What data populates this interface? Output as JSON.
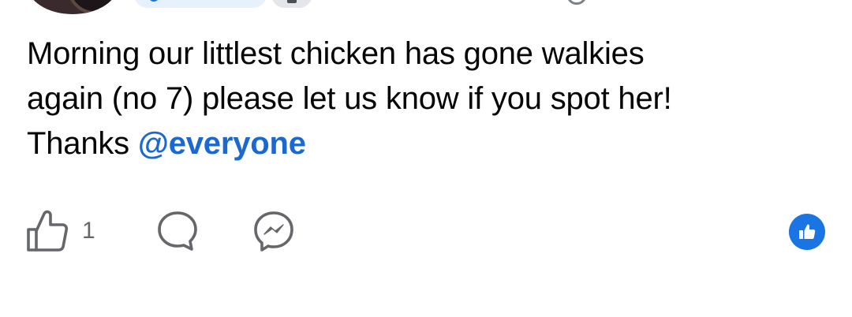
{
  "post": {
    "lines": [
      "Morning our littlest chicken has gone walkies",
      "again (no 7) please let us know if you spot her!",
      "Thanks "
    ],
    "mention": "@everyone"
  },
  "actions": {
    "like_icon": "thumbs-up-icon",
    "like_count": "1",
    "comment_icon": "comment-icon",
    "share_icon": "messenger-icon"
  },
  "reactions": {
    "icon": "like-reaction-icon",
    "color": "#1b74e4"
  },
  "colors": {
    "text": "#050505",
    "mention": "#1a68d0",
    "secondary": "#65676b",
    "accent": "#1b74e4"
  }
}
